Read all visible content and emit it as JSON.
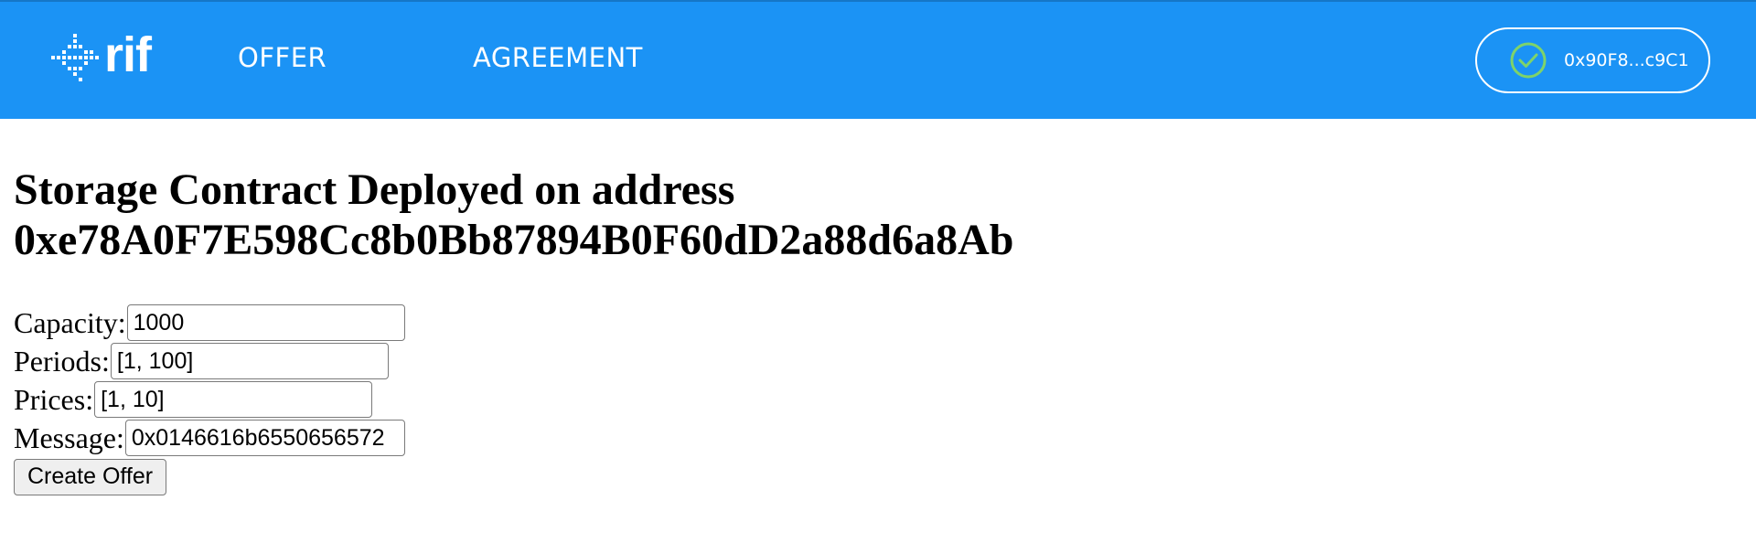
{
  "header": {
    "logo_text": "rif",
    "nav": [
      {
        "label": "OFFER"
      },
      {
        "label": "AGREEMENT"
      }
    ],
    "account": {
      "address": "0x90F8...c9C1",
      "status_icon": "check-circle-icon",
      "status_color": "#7ed36a"
    },
    "background_color": "#1b93f5"
  },
  "main": {
    "title_line1": "Storage Contract Deployed on address",
    "title_line2": "0xe78A0F7E598Cc8b0Bb87894B0F60dD2a88d6a8Ab",
    "form": {
      "capacity_label": "Capacity:",
      "capacity_value": "1000",
      "periods_label": "Periods:",
      "periods_value": "[1, 100]",
      "prices_label": "Prices:",
      "prices_value": "[1, 10]",
      "message_label": "Message:",
      "message_value": "0x0146616b6550656572",
      "submit_label": "Create Offer"
    }
  }
}
